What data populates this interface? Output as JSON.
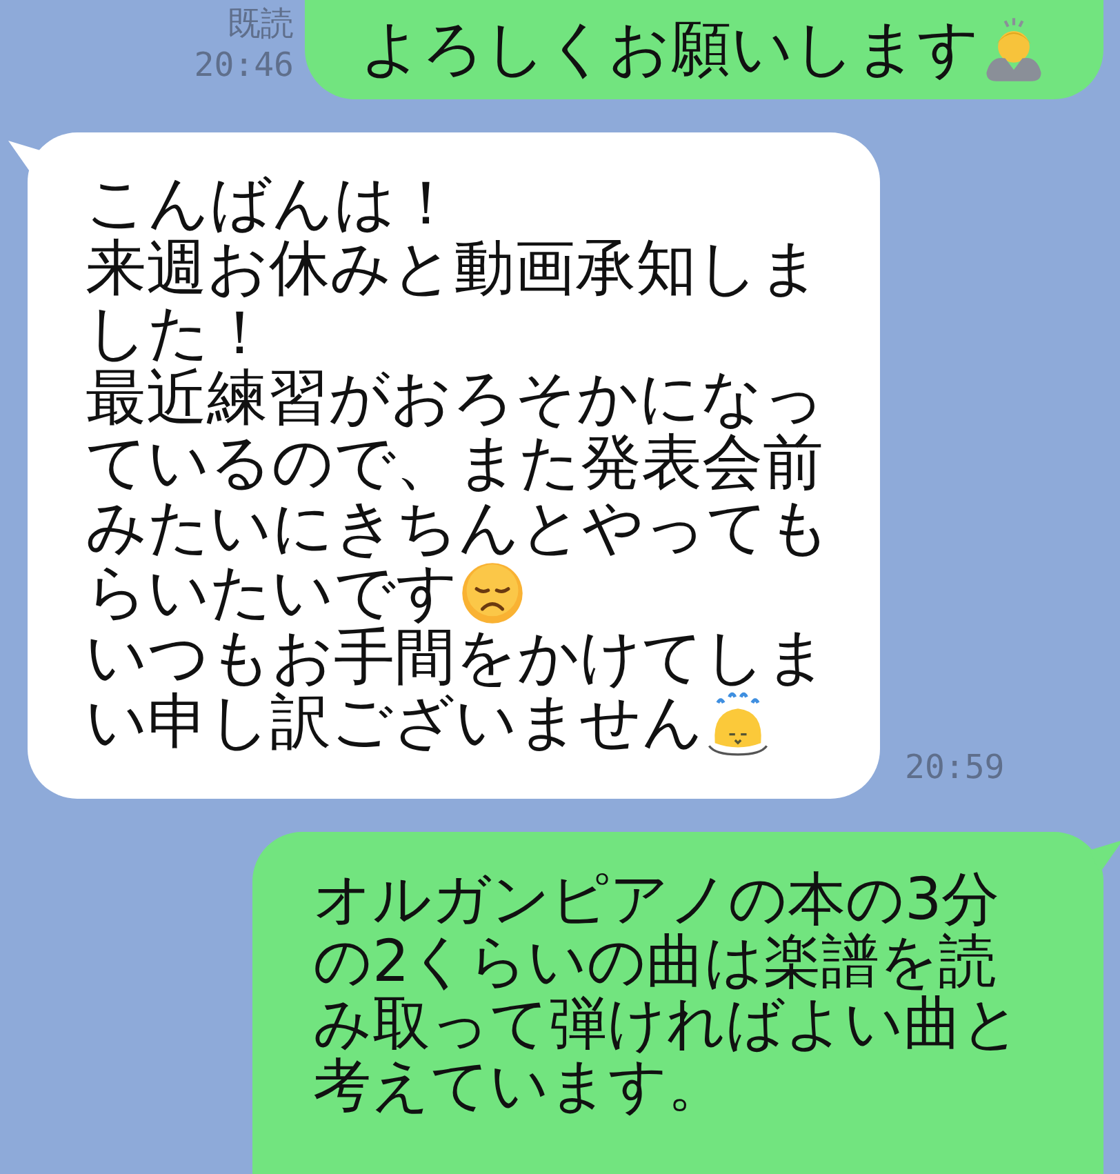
{
  "messages": [
    {
      "kind": "sent",
      "read_label": "既読",
      "time": "20:46",
      "lines": [
        {
          "text": "よろしくお願いします",
          "emoji": true
        }
      ]
    },
    {
      "kind": "received",
      "time": "20:59",
      "lines": [
        {
          "text": "こんばんは！"
        },
        {
          "text": "来週お休みと動画承知しま"
        },
        {
          "text": "した！"
        },
        {
          "text": "最近練習がおろそかになっ"
        },
        {
          "text": "ているので、また発表会前"
        },
        {
          "text": "みたいにきちんとやっても"
        },
        {
          "text": "らいたいです",
          "emoji": true
        },
        {
          "text": "いつもお手間をかけてしま"
        },
        {
          "text": "い申し訳ございません",
          "emoji": true
        }
      ]
    },
    {
      "kind": "sent",
      "lines": [
        {
          "text": "オルガンピアノの本の3分"
        },
        {
          "text": "の2くらいの曲は楽譜を読"
        },
        {
          "text": "み取って弾ければよい曲と"
        },
        {
          "text": "考えています。"
        }
      ]
    }
  ]
}
